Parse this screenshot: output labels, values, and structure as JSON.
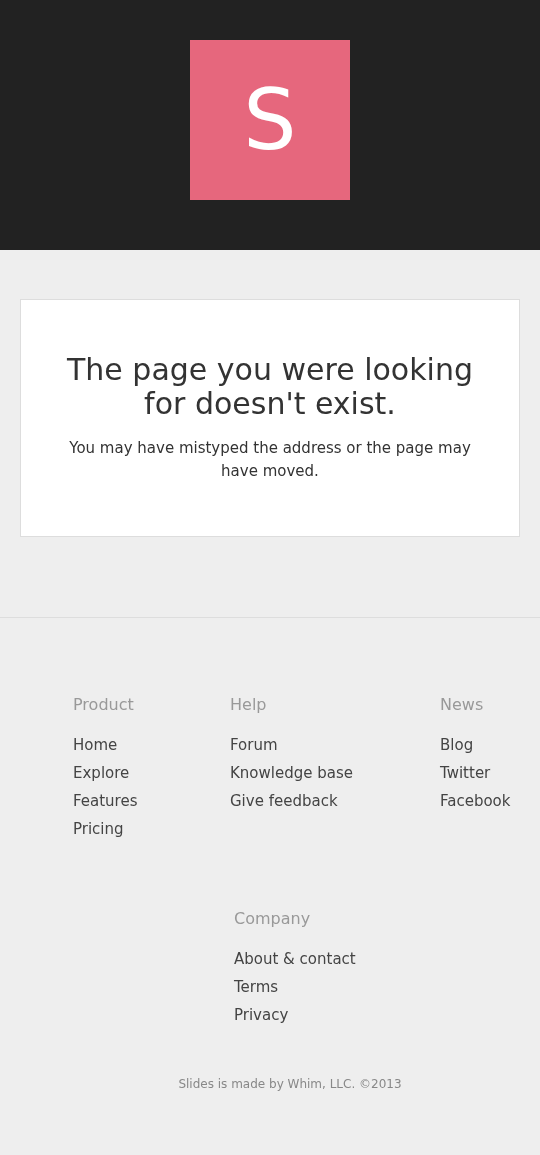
{
  "logo": {
    "letter": "S"
  },
  "error": {
    "title": "The page you were looking for doesn't exist.",
    "message": "You may have mistyped the address or the page may have moved."
  },
  "footer": {
    "columns": [
      {
        "heading": "Product",
        "links": [
          "Home",
          "Explore",
          "Features",
          "Pricing"
        ]
      },
      {
        "heading": "Help",
        "links": [
          "Forum",
          "Knowledge base",
          "Give feedback"
        ]
      },
      {
        "heading": "News",
        "links": [
          "Blog",
          "Twitter",
          "Facebook"
        ]
      }
    ],
    "company": {
      "heading": "Company",
      "links": [
        "About & contact",
        "Terms",
        "Privacy"
      ]
    },
    "credit": "Slides is made by Whim, LLC. ©2013"
  }
}
